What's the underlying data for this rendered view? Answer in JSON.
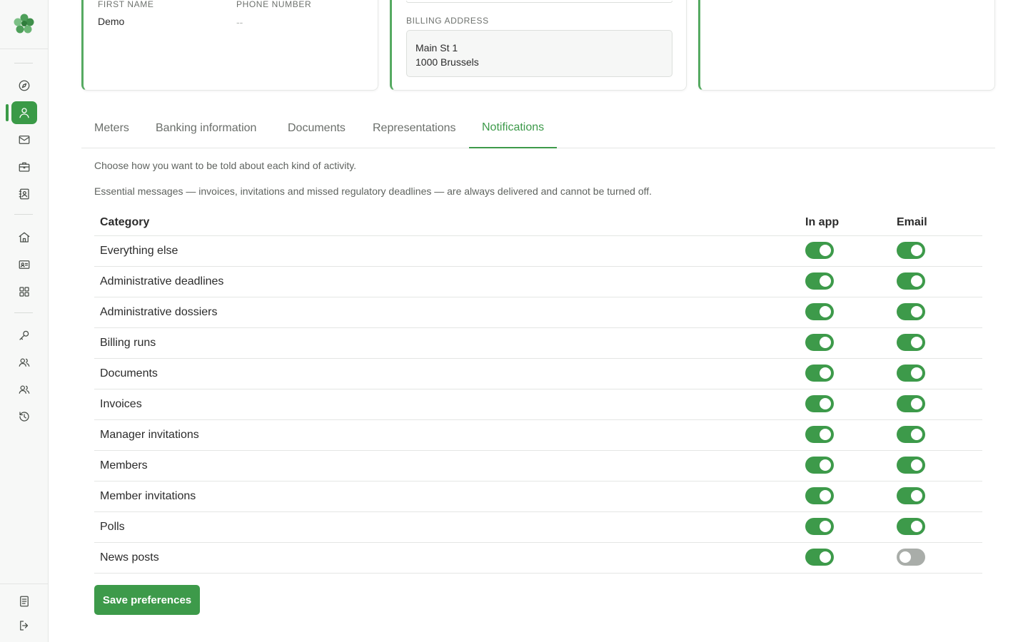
{
  "colors": {
    "accent": "#3d9a4a",
    "toggle_off": "#a9ada9",
    "card_border": "#56aa62"
  },
  "sidebar": {
    "logo_icon": "clover-logo-icon",
    "items": [
      {
        "icon": "compass-icon"
      },
      {
        "icon": "user-icon",
        "active": true
      },
      {
        "icon": "mail-icon"
      },
      {
        "icon": "briefcase-icon"
      },
      {
        "icon": "contact-book-icon"
      },
      {
        "icon": "home-icon"
      },
      {
        "icon": "id-card-icon"
      },
      {
        "icon": "grid-icon"
      },
      {
        "icon": "key-icon"
      },
      {
        "icon": "users-icon"
      },
      {
        "icon": "users-group-icon"
      },
      {
        "icon": "history-icon"
      },
      {
        "icon": "document-icon"
      },
      {
        "icon": "logout-icon"
      }
    ]
  },
  "profile_card": {
    "first_name_label": "FIRST NAME",
    "first_name_value": "Demo",
    "phone_label": "PHONE NUMBER",
    "phone_value": "--"
  },
  "billing_card": {
    "label": "BILLING ADDRESS",
    "line1": "Main St 1",
    "line2": "1000 Brussels"
  },
  "tabs": [
    {
      "label": "Meters"
    },
    {
      "label": "Banking information"
    },
    {
      "label": "Documents"
    },
    {
      "label": "Representations"
    },
    {
      "label": "Notifications",
      "active": true
    }
  ],
  "notifications": {
    "intro": "Choose how you want to be told about each kind of activity.",
    "essential_note": "Essential messages — invoices, invitations and missed regulatory deadlines — are always delivered and cannot be turned off.",
    "headers": {
      "category": "Category",
      "in_app": "In app",
      "email": "Email"
    },
    "rows": [
      {
        "label": "Everything else",
        "in_app": true,
        "email": true
      },
      {
        "label": "Administrative deadlines",
        "in_app": true,
        "email": true
      },
      {
        "label": "Administrative dossiers",
        "in_app": true,
        "email": true
      },
      {
        "label": "Billing runs",
        "in_app": true,
        "email": true
      },
      {
        "label": "Documents",
        "in_app": true,
        "email": true
      },
      {
        "label": "Invoices",
        "in_app": true,
        "email": true
      },
      {
        "label": "Manager invitations",
        "in_app": true,
        "email": true
      },
      {
        "label": "Members",
        "in_app": true,
        "email": true
      },
      {
        "label": "Member invitations",
        "in_app": true,
        "email": true
      },
      {
        "label": "Polls",
        "in_app": true,
        "email": true
      },
      {
        "label": "News posts",
        "in_app": true,
        "email": false
      }
    ],
    "save_label": "Save preferences"
  }
}
